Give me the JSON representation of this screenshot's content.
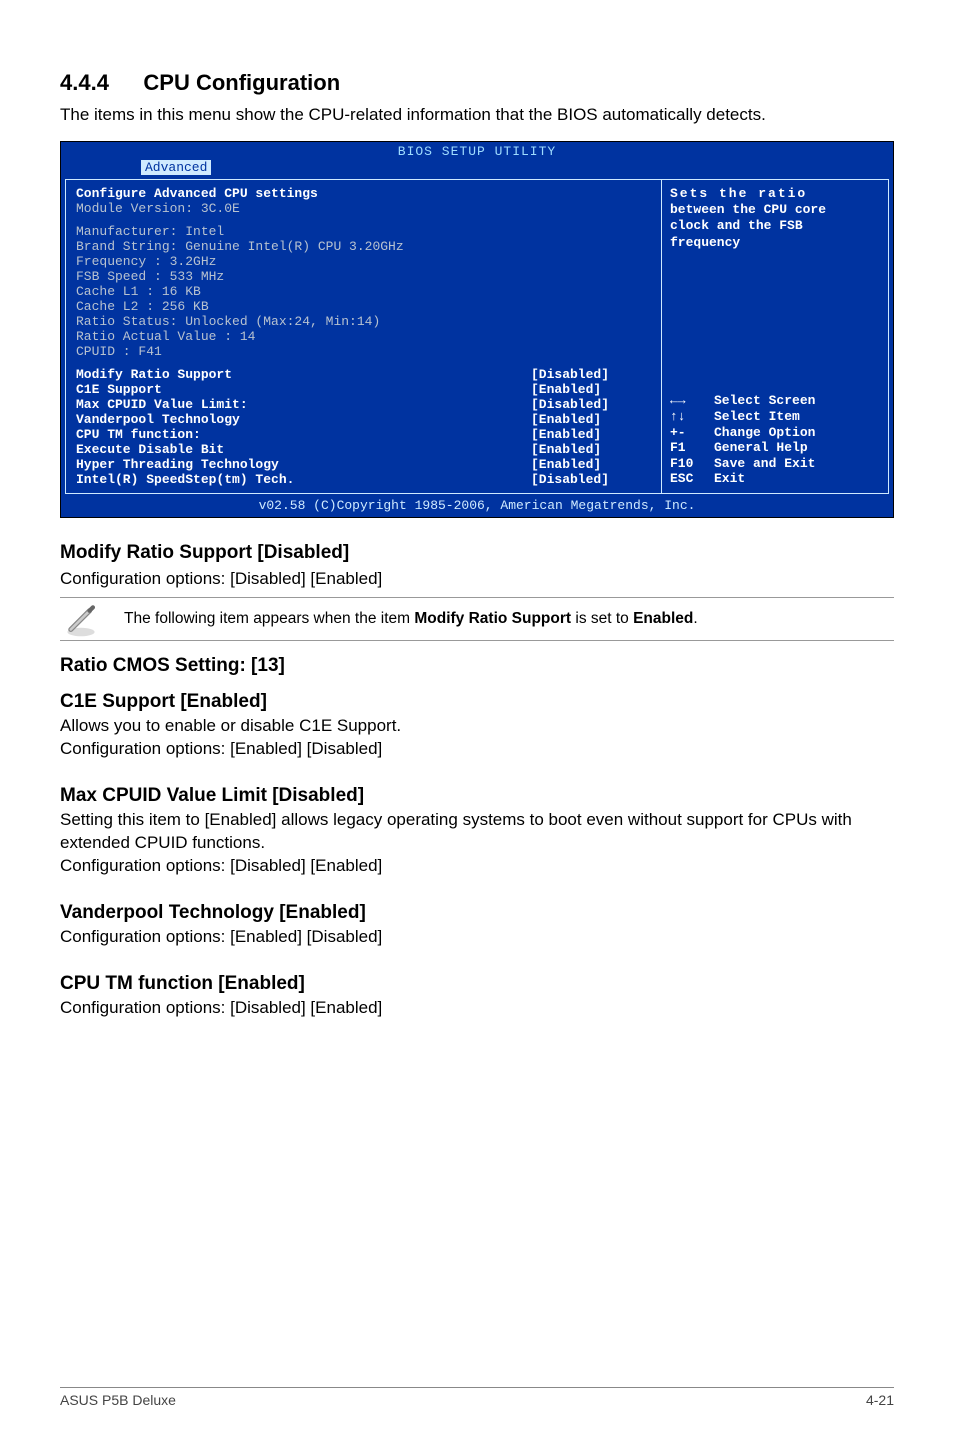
{
  "section": {
    "number": "4.4.4",
    "title": "CPU Configuration"
  },
  "intro": "The items in this menu show the CPU-related information that the BIOS automatically detects.",
  "bios": {
    "title": "BIOS SETUP UTILITY",
    "tab": "Advanced",
    "header1": "Configure Advanced CPU settings",
    "header2": "Module Version: 3C.0E",
    "info": {
      "manufacturer": "Manufacturer: Intel",
      "brand": "Brand String: Genuine Intel(R) CPU 3.20GHz",
      "frequency": "Frequency   : 3.2GHz",
      "fsb": "FSB Speed   : 533 MHz",
      "l1": "Cache L1    : 16 KB",
      "l2": "Cache L2    : 256 KB",
      "ratio_status": "Ratio Status: Unlocked (Max:24, Min:14)",
      "ratio_actual": "Ratio Actual Value : 14",
      "cpuid": "CPUID       : F41"
    },
    "settings": [
      {
        "label": "  Modify Ratio Support",
        "value": "[Disabled]"
      },
      {
        "label": "C1E Support",
        "value": "[Enabled]"
      },
      {
        "label": "Max CPUID Value Limit:",
        "value": "[Disabled]"
      },
      {
        "label": "Vanderpool Technology",
        "value": "[Enabled]"
      },
      {
        "label": "CPU TM function:",
        "value": "[Enabled]"
      },
      {
        "label": "Execute Disable Bit",
        "value": "[Enabled]"
      },
      {
        "label": "Hyper Threading Technology",
        "value": "[Enabled]"
      },
      {
        "label": "Intel(R) SpeedStep(tm) Tech.",
        "value": "[Disabled]"
      }
    ],
    "help": {
      "l1": "Sets the ratio",
      "l2": "between the CPU core",
      "l3": "clock and the FSB",
      "l4": "frequency"
    },
    "keys": [
      {
        "k": "←→",
        "d": "Select Screen"
      },
      {
        "k": "↑↓",
        "d": "Select Item"
      },
      {
        "k": "+-",
        "d": "Change Option"
      },
      {
        "k": "F1",
        "d": "General Help"
      },
      {
        "k": "F10",
        "d": "Save and Exit"
      },
      {
        "k": "ESC",
        "d": "Exit"
      }
    ],
    "footer": "v02.58 (C)Copyright 1985-2006, American Megatrends, Inc."
  },
  "headings": {
    "modify_ratio": "Modify Ratio Support [Disabled]",
    "ratio_cmos": "Ratio CMOS Setting: [13]",
    "c1e": "C1E Support [Enabled]",
    "max_cpuid": "Max CPUID Value Limit [Disabled]",
    "vanderpool": "Vanderpool Technology [Enabled]",
    "cpu_tm": "CPU TM function [Enabled]"
  },
  "paragraphs": {
    "modify_ratio": "Configuration options: [Disabled] [Enabled]",
    "note_prefix": "The following item appears when the item ",
    "note_bold": "Modify Ratio Support",
    "note_mid": " is set to ",
    "note_bold2": "Enabled",
    "note_suffix": ".",
    "c1e_l1": "Allows you to enable or disable C1E Support.",
    "c1e_l2": "Configuration options: [Enabled] [Disabled]",
    "max_cpuid_l1": "Setting this item to [Enabled] allows legacy operating systems to boot even without support for CPUs with extended CPUID functions.",
    "max_cpuid_l2": "Configuration options: [Disabled] [Enabled]",
    "vanderpool": "Configuration options: [Enabled] [Disabled]",
    "cpu_tm": "Configuration options: [Disabled] [Enabled]"
  },
  "footer": {
    "left": "ASUS P5B Deluxe",
    "right": "4-21"
  }
}
